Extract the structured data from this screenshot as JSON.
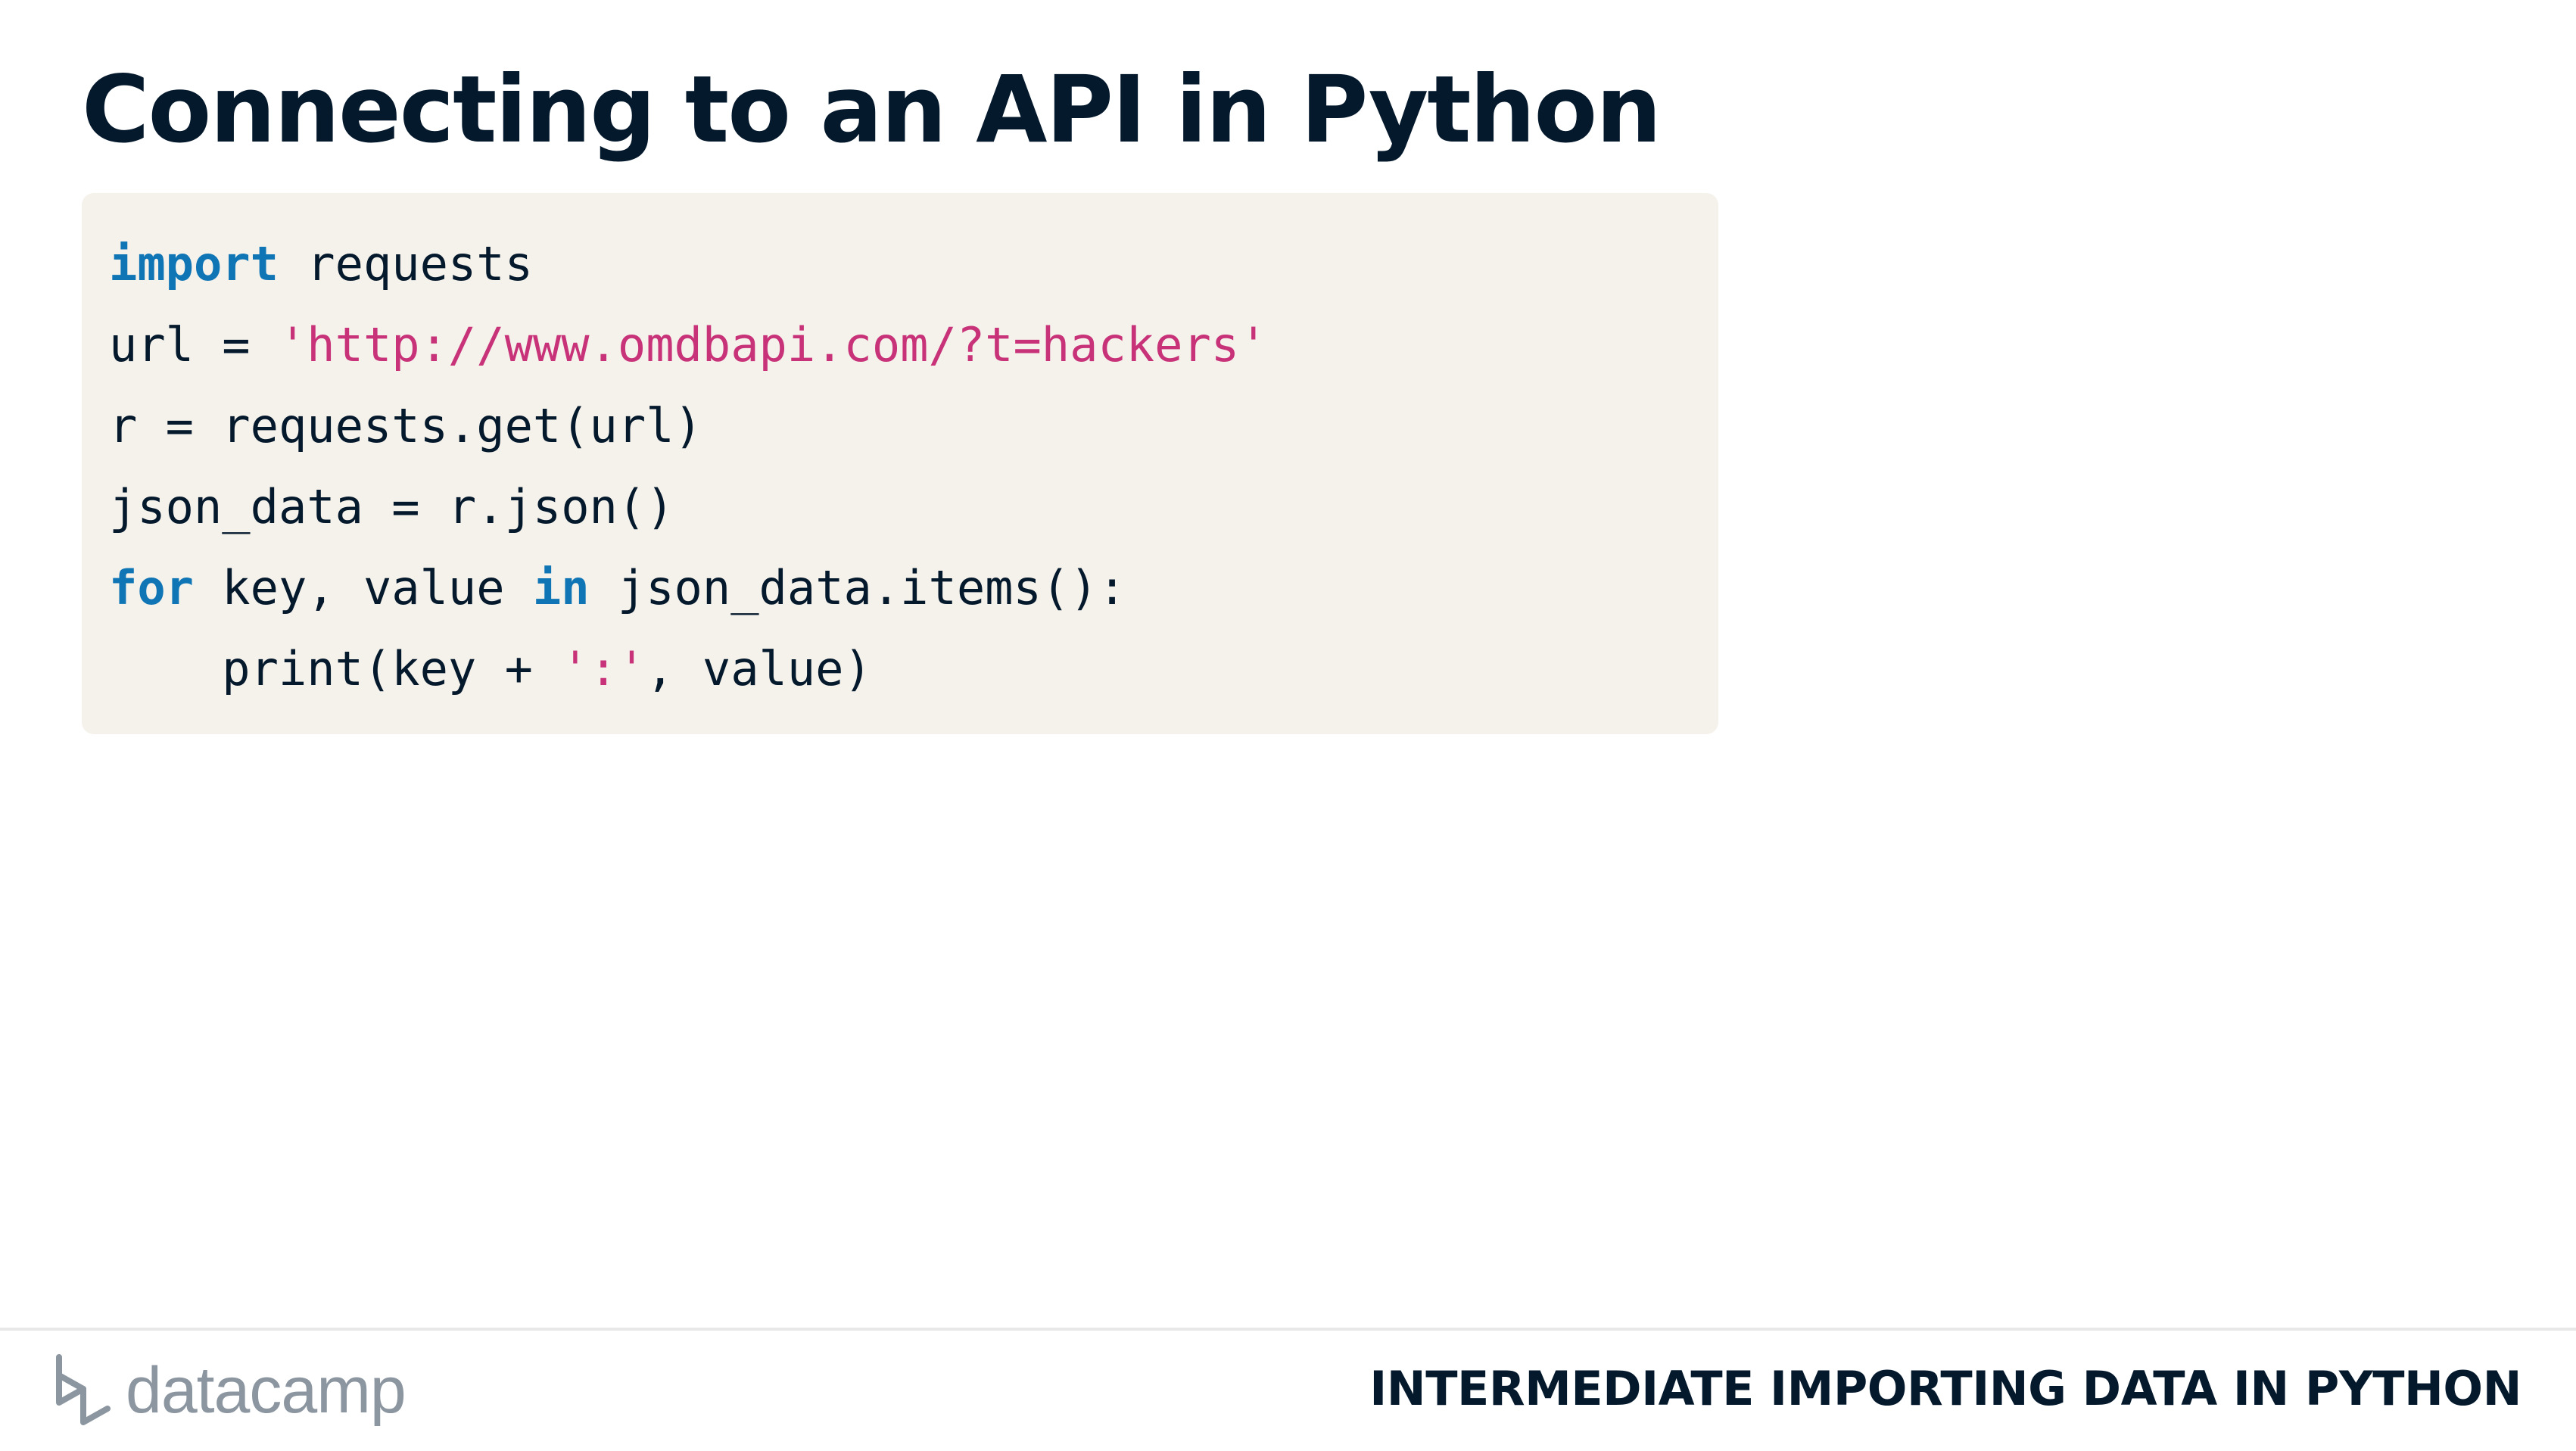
{
  "slide": {
    "title": "Connecting to an API in Python"
  },
  "code": {
    "lines": [
      [
        {
          "text": "import",
          "kind": "keyword"
        },
        {
          "text": " requests",
          "kind": "plain"
        }
      ],
      [
        {
          "text": "url = ",
          "kind": "plain"
        },
        {
          "text": "'http://www.omdbapi.com/?t=hackers'",
          "kind": "string"
        }
      ],
      [
        {
          "text": "r = requests.get(url)",
          "kind": "plain"
        }
      ],
      [
        {
          "text": "json_data = r.json()",
          "kind": "plain"
        }
      ],
      [
        {
          "text": "for",
          "kind": "keyword"
        },
        {
          "text": " key, value ",
          "kind": "plain"
        },
        {
          "text": "in",
          "kind": "keyword"
        },
        {
          "text": " json_data.items():",
          "kind": "plain"
        }
      ],
      [
        {
          "text": "    print(key + ",
          "kind": "plain"
        },
        {
          "text": "':'",
          "kind": "string"
        },
        {
          "text": ", value)",
          "kind": "plain"
        }
      ]
    ]
  },
  "footer": {
    "logo_text": "datacamp",
    "logo_icon": "datacamp-logo-icon",
    "course_name": "INTERMEDIATE IMPORTING DATA IN PYTHON"
  },
  "colors": {
    "background": "#ffffff",
    "text": "#05192d",
    "code_background": "#f5f2ec",
    "keyword": "#0f75b5",
    "string": "#c83278",
    "logo": "#8c96a0"
  }
}
